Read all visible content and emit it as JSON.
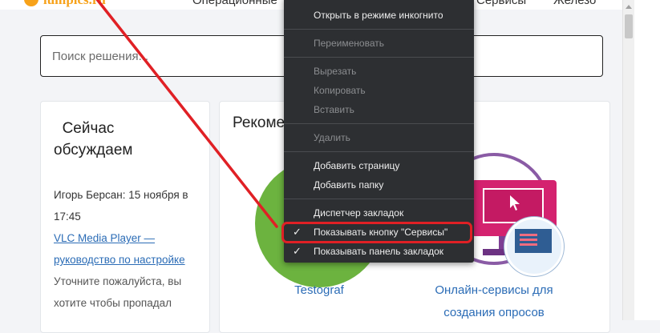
{
  "header": {
    "logo_text": "lumpics.ru",
    "nav": [
      "Операционные",
      "Сервисы",
      "Железо"
    ]
  },
  "search": {
    "placeholder": "Поиск решения..."
  },
  "sidebar": {
    "title": "Сейчас обсуждаем",
    "author_date": "Игорь Берсан: 15 ноября в 17:45",
    "link": "VLC Media Player — руководство по настройке",
    "text": "Уточните пожалуйста, вы хотите чтобы пропадал"
  },
  "main": {
    "title": "Рекомендуем",
    "items": [
      {
        "label": "Testograf"
      },
      {
        "label": "Онлайн-сервисы для создания опросов"
      }
    ]
  },
  "context_menu": {
    "items": [
      {
        "label": "Открыть в режиме инкогнито",
        "disabled": false
      },
      {
        "label": "Переименовать",
        "disabled": true
      },
      {
        "label": "Вырезать",
        "disabled": true
      },
      {
        "label": "Копировать",
        "disabled": true
      },
      {
        "label": "Вставить",
        "disabled": true
      },
      {
        "label": "Удалить",
        "disabled": true
      },
      {
        "label": "Добавить страницу",
        "disabled": false
      },
      {
        "label": "Добавить папку",
        "disabled": false
      },
      {
        "label": "Диспетчер закладок",
        "disabled": false
      },
      {
        "label": "Показывать кнопку \"Сервисы\"",
        "disabled": false,
        "checked": true
      },
      {
        "label": "Показывать панель закладок",
        "disabled": false,
        "checked": true
      }
    ]
  },
  "colors": {
    "menu_bg": "#2d2f32",
    "highlight": "#e02025",
    "link": "#2b6cb6",
    "accent": "#f7a21a"
  }
}
